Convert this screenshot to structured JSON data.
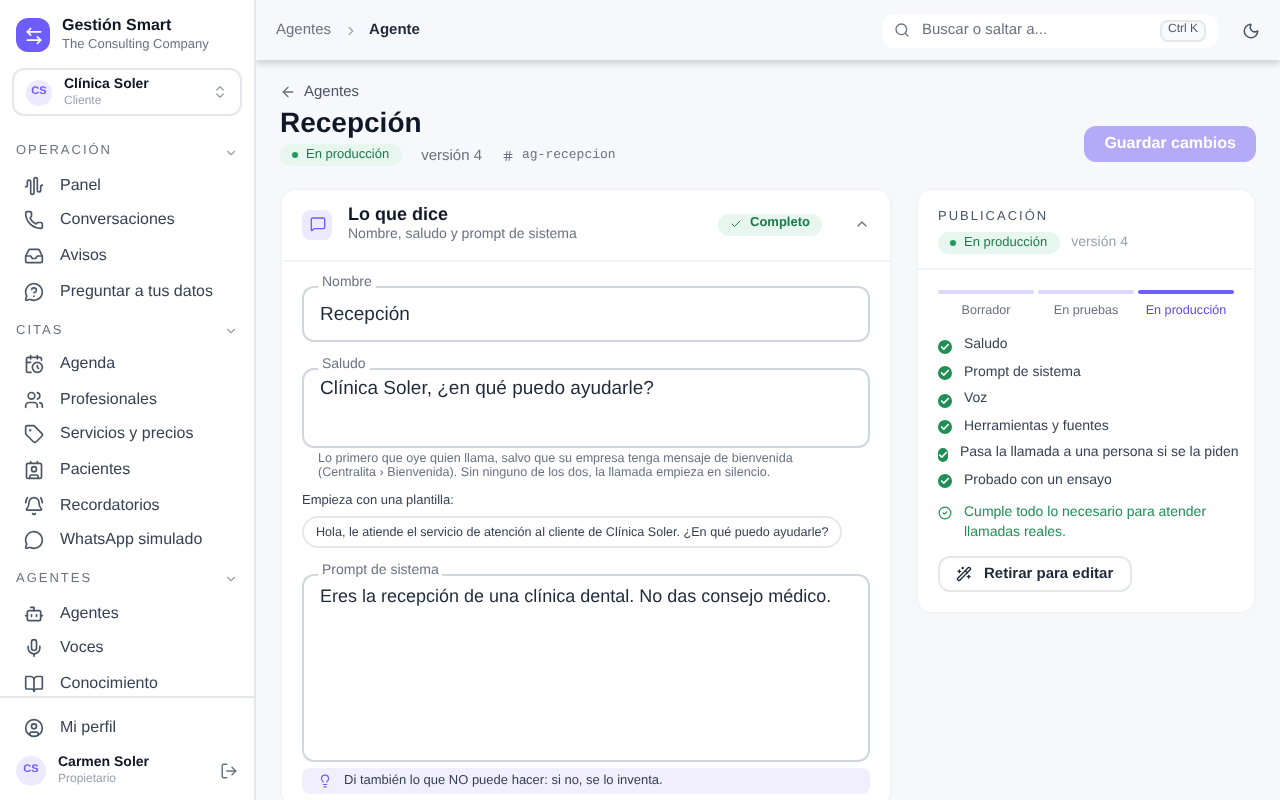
{
  "app": {
    "name": "Gestión Smart",
    "company": "The Consulting Company"
  },
  "client": {
    "initials": "CS",
    "name": "Clínica Soler",
    "role": "Cliente"
  },
  "sidebar": {
    "sections": [
      {
        "title": "OPERACIÓN",
        "expanded": true,
        "items": [
          {
            "label": "Panel"
          },
          {
            "label": "Conversaciones"
          },
          {
            "label": "Avisos"
          },
          {
            "label": "Preguntar a tus datos"
          }
        ]
      },
      {
        "title": "CITAS",
        "expanded": true,
        "items": [
          {
            "label": "Agenda"
          },
          {
            "label": "Profesionales"
          },
          {
            "label": "Servicios y precios"
          },
          {
            "label": "Pacientes"
          },
          {
            "label": "Recordatorios"
          },
          {
            "label": "WhatsApp simulado"
          }
        ]
      },
      {
        "title": "AGENTES",
        "expanded": true,
        "items": [
          {
            "label": "Agentes"
          },
          {
            "label": "Voces"
          },
          {
            "label": "Conocimiento"
          }
        ]
      }
    ]
  },
  "profile_link": "Mi perfil",
  "user": {
    "initials": "CS",
    "name": "Carmen Soler",
    "role": "Propietario"
  },
  "topbar": {
    "breadcrumb": [
      "Agentes",
      "Agente"
    ],
    "search": {
      "placeholder": "Buscar o saltar a...",
      "shortcut": "Ctrl K"
    }
  },
  "page": {
    "back": "Agentes",
    "title": "Recepción",
    "status": "En producción",
    "version": "versión 4",
    "slug": "ag-recepcion",
    "save_button": {
      "label": "Guardar cambios",
      "disabled": true
    }
  },
  "section_card": {
    "title": "Lo que dice",
    "subtitle": "Nombre, saludo y prompt de sistema",
    "badge": "Completo",
    "expanded": true,
    "name_field": {
      "label": "Nombre",
      "value": "Recepción"
    },
    "greeting_field": {
      "label": "Saludo",
      "value": "Clínica Soler, ¿en qué puedo ayudarle?"
    },
    "greeting_hint": "Lo primero que oye quien llama, salvo que su empresa tenga mensaje de bienvenida (Centralita › Bienvenida). Sin ninguno de los dos, la llamada empieza en silencio.",
    "template_label": "Empieza con una plantilla:",
    "templates": [
      "Hola, le atiende el servicio de atención al cliente de Clínica Soler. ¿En qué puedo ayudarle?"
    ],
    "prompt_field": {
      "label": "Prompt de sistema",
      "value": "Eres la recepción de una clínica dental. No das consejo médico."
    },
    "tip": "Di también lo que NO puede hacer: si no, se lo inventa."
  },
  "publication": {
    "title": "PUBLICACIÓN",
    "status": "En producción",
    "version": "versión 4",
    "steps": [
      {
        "label": "Borrador",
        "selected": false
      },
      {
        "label": "En pruebas",
        "selected": false
      },
      {
        "label": "En producción",
        "selected": true
      }
    ],
    "checks": [
      {
        "label": "Saludo",
        "checked": true
      },
      {
        "label": "Prompt de sistema",
        "checked": true
      },
      {
        "label": "Voz",
        "checked": true
      },
      {
        "label": "Herramientas y fuentes",
        "checked": true
      },
      {
        "label": "Pasa la llamada a una persona si se la piden",
        "checked": true
      },
      {
        "label": "Probado con un ensayo",
        "checked": true
      }
    ],
    "summary": "Cumple todo lo necesario para atender llamadas reales.",
    "button": "Retirar para editar"
  }
}
